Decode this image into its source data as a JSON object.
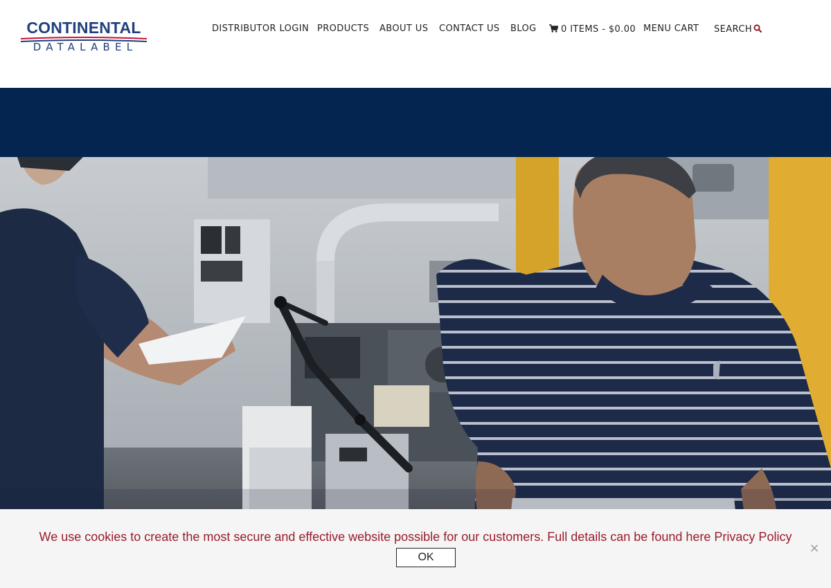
{
  "brand": {
    "logo_word": "CONTINENTAL",
    "logo_sub": "DATALABEL",
    "colors": {
      "navy": "#1f3f7e",
      "red": "#c8102e",
      "banner": "#03254f",
      "accent": "#9b1c2c"
    }
  },
  "nav": {
    "distributor_login": "DISTRIBUTOR LOGIN",
    "products": "PRODUCTS",
    "about_us": "ABOUT US",
    "contact_us": "CONTACT US",
    "blog": "BLOG",
    "cart_summary": "0 ITEMS - $0.00",
    "menu_cart": "MENU CART",
    "search": "SEARCH",
    "icons": {
      "cart": "shopping-cart-icon",
      "search": "magnifier-icon"
    }
  },
  "hero": {
    "image": "Two workers operating label printing machinery in a factory"
  },
  "cookie_notice": {
    "message": "We use cookies to create the most secure and effective website possible for our customers. Full details can be found here",
    "policy_link": "Privacy Policy",
    "ok_label": "OK",
    "close_label": "×"
  }
}
